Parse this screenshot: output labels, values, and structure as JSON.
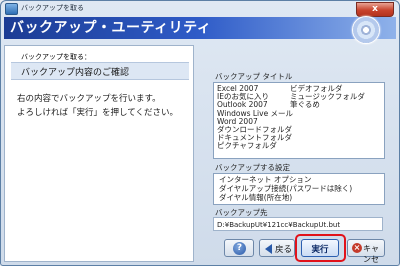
{
  "window": {
    "title": "バックアップを取る",
    "close_glyph": "x"
  },
  "banner": {
    "title": "バックアップ・ユーティリティ"
  },
  "left_panel": {
    "step_label": "バックアップを取る：",
    "step_title": "バックアップ内容のご確認",
    "description_line1": "右の内容でバックアップを行います。",
    "description_line2": "よろしければ「実行」を押してください。"
  },
  "backup_title": {
    "label": "バックアップ タイトル",
    "col1": [
      "Excel 2007",
      "IEのお気に入り",
      "Outlook 2007",
      "Windows Live メール",
      "Word 2007",
      "ダウンロードフォルダ",
      "ドキュメントフォルダ",
      "ピクチャフォルダ"
    ],
    "col2": [
      "ビデオフォルダ",
      "ミュージックフォルダ",
      "筆ぐるめ"
    ]
  },
  "backup_settings": {
    "label": "バックアップする設定",
    "items": [
      "インターネット オプション",
      "ダイヤルアップ接続(パスワードは除く)",
      "ダイヤル情報(所在地)"
    ]
  },
  "backup_dest": {
    "label": "バックアップ先",
    "path": "D:¥BackupUt¥121cc¥BackupUt.but"
  },
  "buttons": {
    "help_glyph": "?",
    "back_label": "戻る",
    "execute_label": "実行",
    "cancel_label": "キャンセル",
    "cancel_glyph": "×"
  }
}
